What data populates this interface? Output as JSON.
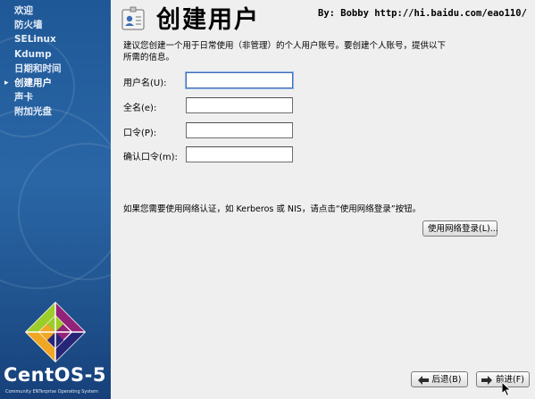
{
  "sidebar": {
    "steps": [
      {
        "label": "欢迎"
      },
      {
        "label": "防火墙"
      },
      {
        "label": "SELinux"
      },
      {
        "label": "Kdump"
      },
      {
        "label": "日期和时间"
      },
      {
        "label": "创建用户",
        "current": true
      },
      {
        "label": "声卡"
      },
      {
        "label": "附加光盘"
      }
    ],
    "brand": "CentOS-5",
    "tagline": "Community ENTerprise Operating System"
  },
  "header": {
    "title": "创建用户",
    "credit": "By: Bobby http://hi.baidu.com/eao110/",
    "icon": "user-badge-icon"
  },
  "intro": "建议您创建一个用于日常使用（非管理）的个人用户账号。要创建个人账号，提供以下所需的信息。",
  "form": {
    "username": {
      "label": "用户名(U):",
      "value": ""
    },
    "fullname": {
      "label": "全名(e):",
      "value": ""
    },
    "password": {
      "label": "口令(P):",
      "value": ""
    },
    "confirm": {
      "label": "确认口令(m):",
      "value": ""
    }
  },
  "network_note": "如果您需要使用网络认证，如 Kerberos 或 NIS，请点击“使用网络登录”按钮。",
  "buttons": {
    "network": "使用网络登录(L)...",
    "back": "后退(B)",
    "forward": "前进(F)"
  },
  "colors": {
    "sidebar": "#2a66a6",
    "window_bg": "#efefef"
  }
}
